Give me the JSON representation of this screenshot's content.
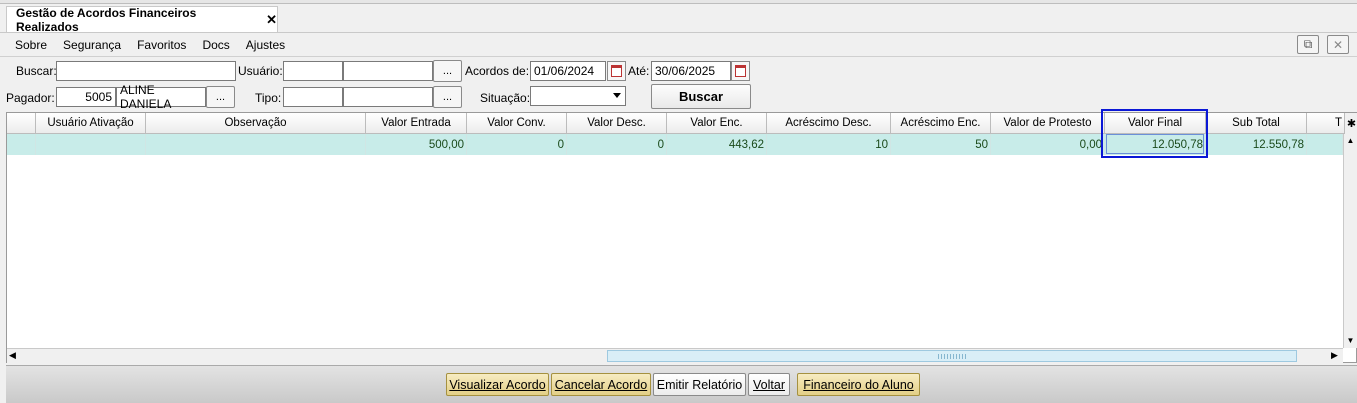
{
  "tab": {
    "title": "Gestão de Acordos Financeiros Realizados",
    "close": "✕"
  },
  "menu": [
    "Sobre",
    "Segurança",
    "Favoritos",
    "Docs",
    "Ajustes"
  ],
  "window_buttons": {
    "popout": "⧉",
    "close": "✕"
  },
  "filters": {
    "buscar_label": "Buscar:",
    "usuario_label": "Usuário:",
    "acordos_de_label": "Acordos de:",
    "acordos_de_value": "01/06/2024",
    "ate_label": "Até:",
    "ate_value": "30/06/2025",
    "pagador_label": "Pagador:",
    "pagador_code": "5005",
    "pagador_name": "ALINE DANIELA",
    "tipo_label": "Tipo:",
    "situacao_label": "Situação:",
    "dots": "...",
    "buscar_button": "Buscar"
  },
  "grid": {
    "columns": [
      "Usuário Ativação",
      "Observação",
      "Valor Entrada",
      "Valor Conv.",
      "Valor Desc.",
      "Valor Enc.",
      "Acréscimo Desc.",
      "Acréscimo Enc.",
      "Valor de Protesto",
      "Valor Final",
      "Sub Total",
      "T"
    ],
    "row": [
      "",
      "",
      "500,00",
      "0",
      "0",
      "443,62",
      "10",
      "50",
      "0,00",
      "12.050,78",
      "12.550,78",
      ""
    ]
  },
  "footer_buttons": [
    "Visualizar Acordo",
    "Cancelar Acordo",
    "Emitir Relatório",
    "Voltar",
    "Financeiro do Aluno"
  ]
}
